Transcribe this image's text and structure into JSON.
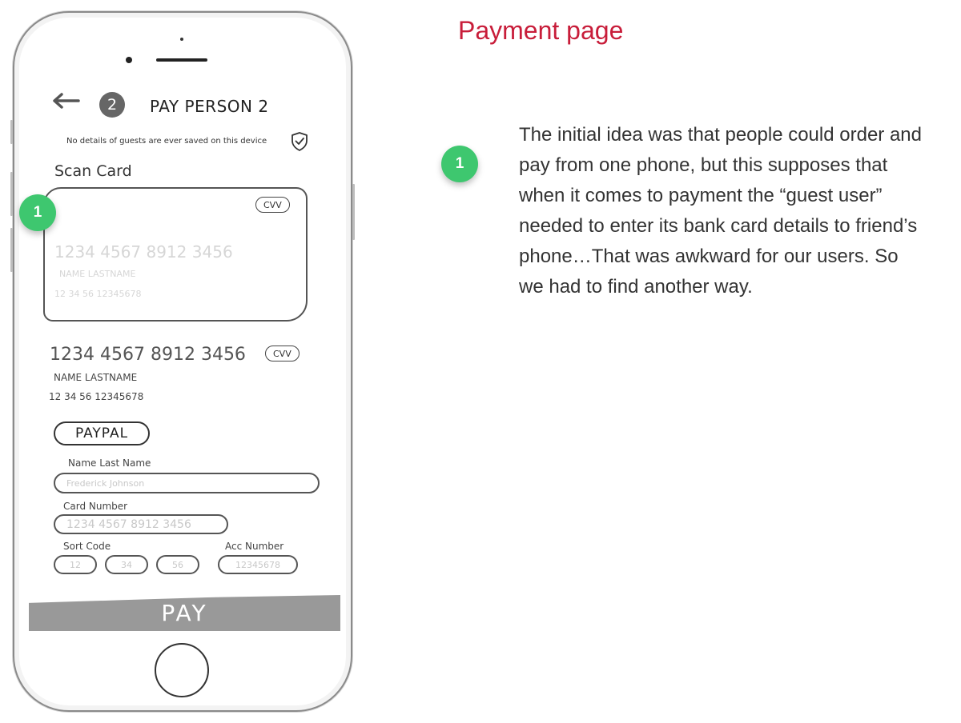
{
  "heading": "Payment page",
  "annotation": {
    "badge": "1",
    "text": "The initial idea was that people could order and pay from one phone, but this supposes that when it comes to payment the “guest user” needed to enter its bank card details to friend’s phone…That was awkward for our users. So we had to find another way."
  },
  "phone": {
    "step_number": "2",
    "title": "PAY PERSON 2",
    "privacy_note": "No details of guests are ever saved on this device",
    "scan_label": "Scan Card",
    "scan_badge": "1",
    "scan_card": {
      "cvv": "CVV",
      "number": "1234 4567 8912 3456",
      "name": "NAME LASTNAME",
      "meta": "12 34 56   12345678"
    },
    "saved_card": {
      "number": "1234 4567 8912 3456",
      "cvv": "CVV",
      "name": "NAME LASTNAME",
      "meta": "12 34 56   12345678"
    },
    "paypal_label": "PAYPAL",
    "form": {
      "name_label": "Name Last Name",
      "name_placeholder": "Frederick Johnson",
      "card_label": "Card Number",
      "card_placeholder": "1234 4567 8912 3456",
      "sort_label": "Sort Code",
      "sort_1": "12",
      "sort_2": "34",
      "sort_3": "56",
      "acc_label": "Acc Number",
      "acc_placeholder": "12345678"
    },
    "pay_label": "PAY"
  },
  "colors": {
    "heading": "#c81d3a",
    "badge_green": "#3ec76f",
    "pay_bar": "#999999"
  },
  "icons": [
    "back-arrow-icon",
    "shield-check-icon"
  ]
}
